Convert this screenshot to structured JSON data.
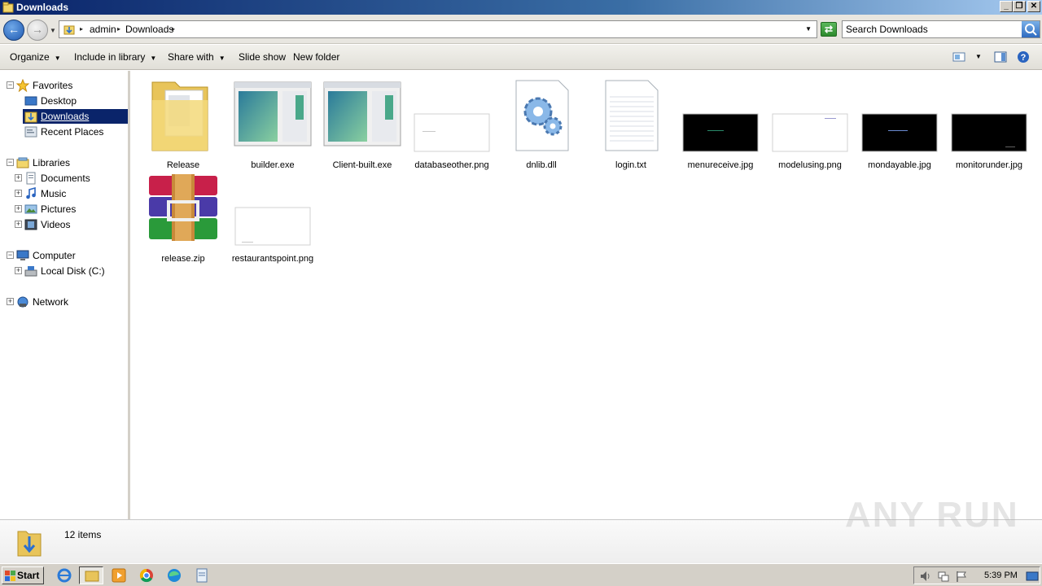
{
  "window": {
    "title": "Downloads",
    "controls": [
      "_",
      "❐",
      "✕"
    ]
  },
  "address": {
    "crumbs": [
      "admin",
      "Downloads"
    ],
    "search_placeholder": "Search Downloads"
  },
  "toolbar": {
    "organize": "Organize",
    "include_in_library": "Include in library",
    "share_with": "Share with",
    "slide_show": "Slide show",
    "new_folder": "New folder"
  },
  "nav": {
    "favorites": "Favorites",
    "desktop": "Desktop",
    "downloads": "Downloads",
    "recent_places": "Recent Places",
    "libraries": "Libraries",
    "documents": "Documents",
    "music": "Music",
    "pictures": "Pictures",
    "videos": "Videos",
    "computer": "Computer",
    "local_disk": "Local Disk (C:)",
    "network": "Network"
  },
  "files": [
    {
      "name": "Release",
      "kind": "folder"
    },
    {
      "name": "builder.exe",
      "kind": "exe"
    },
    {
      "name": "Client-built.exe",
      "kind": "exe"
    },
    {
      "name": "databaseother.png",
      "kind": "image-white"
    },
    {
      "name": "dnlib.dll",
      "kind": "dll"
    },
    {
      "name": "login.txt",
      "kind": "txt"
    },
    {
      "name": "menureceive.jpg",
      "kind": "image-black"
    },
    {
      "name": "modelusing.png",
      "kind": "image-white"
    },
    {
      "name": "mondayable.jpg",
      "kind": "image-black"
    },
    {
      "name": "monitorunder.jpg",
      "kind": "image-black"
    },
    {
      "name": "release.zip",
      "kind": "archive"
    },
    {
      "name": "restaurantspoint.png",
      "kind": "image-white"
    }
  ],
  "details": {
    "count": "12 items"
  },
  "watermark": "ANY RUN",
  "taskbar": {
    "start": "Start",
    "clock": "5:39 PM"
  }
}
